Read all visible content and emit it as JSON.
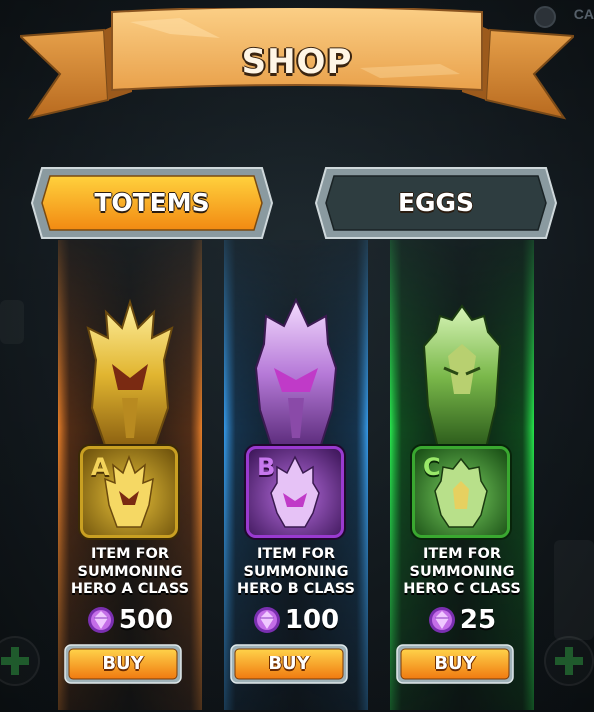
{
  "header": {
    "title": "SHOP",
    "corner_text": "CA"
  },
  "tabs": [
    {
      "label": "TOTEMS",
      "active": true
    },
    {
      "label": "EGGS",
      "active": false
    }
  ],
  "items": [
    {
      "class_letter": "A",
      "desc_lines": [
        "ITEM FOR",
        "SUMMONING",
        "HERO A CLASS"
      ],
      "price": "500",
      "buy_label": "BUY",
      "color": "#d4a019"
    },
    {
      "class_letter": "B",
      "desc_lines": [
        "ITEM FOR",
        "SUMMONING",
        "HERO B CLASS"
      ],
      "price": "100",
      "buy_label": "BUY",
      "color": "#a24ad8"
    },
    {
      "class_letter": "C",
      "desc_lines": [
        "ITEM FOR",
        "SUMMONING",
        "HERO C CLASS"
      ],
      "price": "25",
      "buy_label": "BUY",
      "color": "#3fb33a"
    }
  ],
  "colors": {
    "accent_orange": "#f7a21a",
    "tab_inactive": "#2c3a3e",
    "gem": "#c46ee8"
  },
  "icons": [
    "gem-icon",
    "plus-icon",
    "totem-icon"
  ]
}
